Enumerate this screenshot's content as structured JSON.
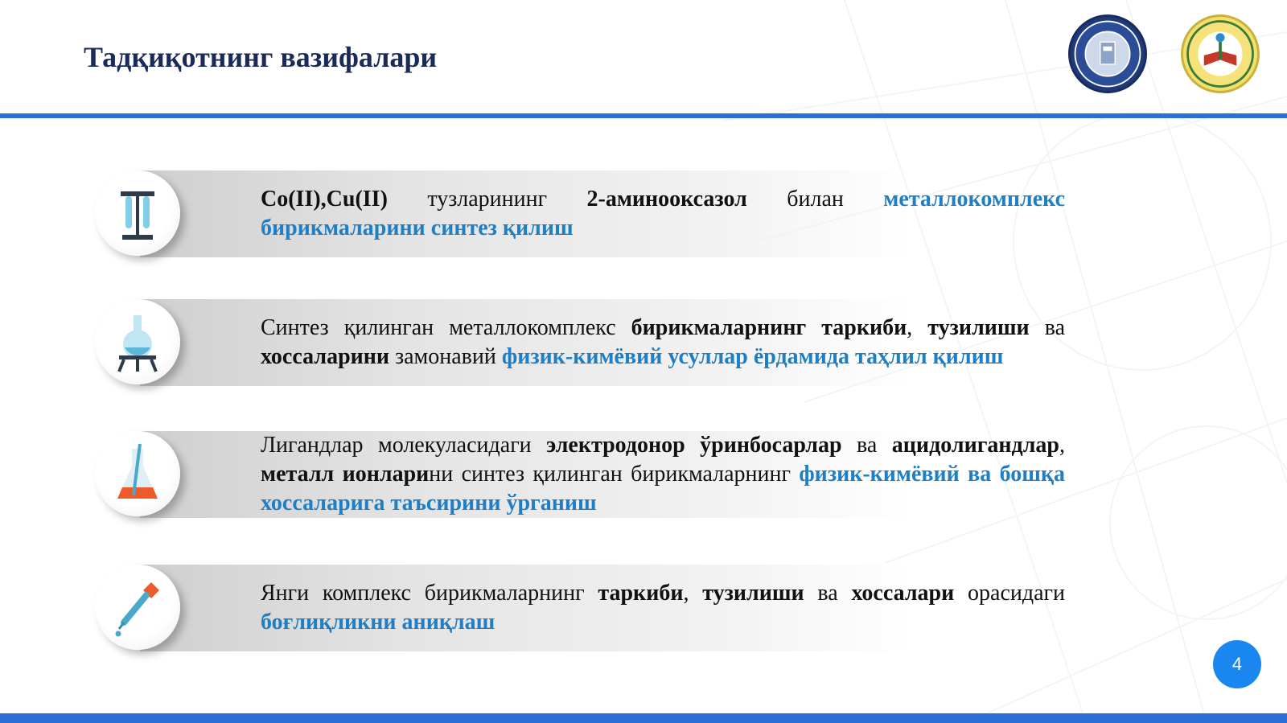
{
  "slide": {
    "title": "Тадқиқотнинг вазифалари",
    "page_number": "4"
  },
  "tasks": [
    {
      "icon": "test-tube-rack-icon",
      "parts": [
        {
          "t": "Co(II),Cu(II)",
          "s": "b"
        },
        {
          "t": " тузларининг ",
          "s": ""
        },
        {
          "t": "2-аминооксазол",
          "s": "b"
        },
        {
          "t": " билан ",
          "s": ""
        },
        {
          "t": "металлокомплекс бирикмаларини синтез қилиш",
          "s": "blue"
        }
      ]
    },
    {
      "icon": "flask-stand-icon",
      "parts": [
        {
          "t": "Синтез қилинган металлокомплекс ",
          "s": ""
        },
        {
          "t": "бирикмаларнинг таркиби",
          "s": "b"
        },
        {
          "t": ", ",
          "s": ""
        },
        {
          "t": "тузилиши",
          "s": "b"
        },
        {
          "t": " ва ",
          "s": ""
        },
        {
          "t": "хоссаларини",
          "s": "b"
        },
        {
          "t": " замонавий ",
          "s": ""
        },
        {
          "t": "физик-кимёвий усуллар ёрдамида таҳлил қилиш",
          "s": "blue"
        }
      ]
    },
    {
      "icon": "conical-flask-icon",
      "parts": [
        {
          "t": "Лигандлар молекуласидаги ",
          "s": ""
        },
        {
          "t": "электродонор ўринбосарлар",
          "s": "b"
        },
        {
          "t": " ва ",
          "s": ""
        },
        {
          "t": "ацидолигандлар",
          "s": "b"
        },
        {
          "t": ", ",
          "s": ""
        },
        {
          "t": "металл ионлари",
          "s": "b"
        },
        {
          "t": "ни синтез қилинган бирикмаларнинг ",
          "s": ""
        },
        {
          "t": "физик-кимёвий ва бошқа хоссаларига таъсирини ўрганиш",
          "s": "blue"
        }
      ]
    },
    {
      "icon": "pipette-icon",
      "parts": [
        {
          "t": "Янги комплекс бирикмаларнинг ",
          "s": ""
        },
        {
          "t": "таркиби",
          "s": "b"
        },
        {
          "t": ", ",
          "s": ""
        },
        {
          "t": "тузилиши",
          "s": "b"
        },
        {
          "t": " ва ",
          "s": ""
        },
        {
          "t": "хоссалари",
          "s": "b"
        },
        {
          "t": " орасидаги ",
          "s": ""
        },
        {
          "t": "боғлиқликни аниқлаш",
          "s": "blue"
        }
      ]
    }
  ],
  "colors": {
    "title": "#1a2a5a",
    "accent_blue": "#1e7fc6",
    "rule": "#2a6fd6",
    "page_badge": "#1a86f0"
  }
}
